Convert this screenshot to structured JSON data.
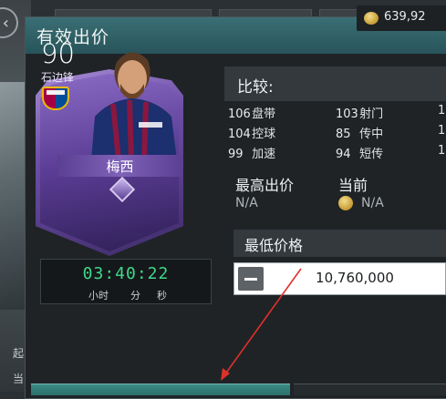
{
  "background": {
    "text_left_1": "起",
    "text_left_2": "当"
  },
  "modal": {
    "title": "有效出价",
    "coins": "639,92"
  },
  "card": {
    "rating": "90",
    "position": "石边锋",
    "name": "梅西",
    "club_badge": "fc-barcelona-badge"
  },
  "timer": {
    "value": "03:40:22",
    "units": [
      "小时",
      "分",
      "秒"
    ]
  },
  "compare": {
    "title": "比较:",
    "stats": [
      {
        "value": "106",
        "label": "盘带"
      },
      {
        "value": "103",
        "label": "射门"
      },
      {
        "value": "104",
        "label": "控球"
      },
      {
        "value": "85",
        "label": "传中"
      },
      {
        "value": "99",
        "label": "加速"
      },
      {
        "value": "94",
        "label": "短传"
      }
    ],
    "edge_values": [
      "1",
      "1",
      "1"
    ]
  },
  "bids": {
    "highest_label": "最高出价",
    "highest_value": "N/A",
    "current_label": "当前",
    "current_value": "N/A"
  },
  "min_price": {
    "label": "最低价格",
    "value": "10,760,000"
  },
  "colors": {
    "header_teal": "#2f6268",
    "timer_green": "#3fd98a",
    "annotation_red": "#e0302a"
  }
}
